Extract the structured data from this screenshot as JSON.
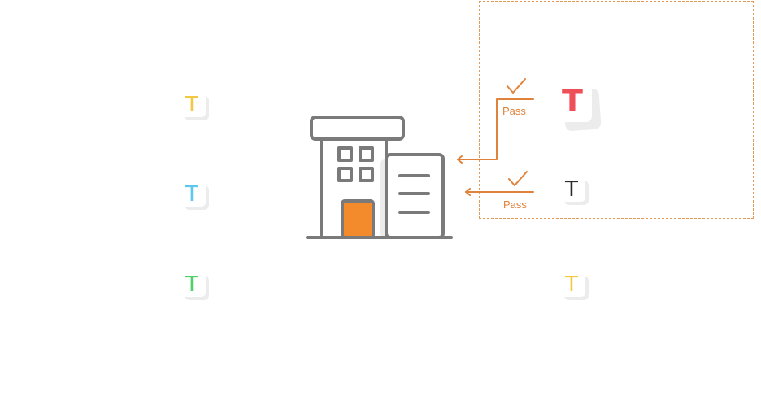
{
  "connectors": [
    {
      "label": "Pass",
      "color": "#e0823a"
    },
    {
      "label": "Pass",
      "color": "#e0823a"
    }
  ],
  "tiles": {
    "left": [
      {
        "glyph": "T",
        "color": "#f5c842"
      },
      {
        "glyph": "T",
        "color": "#5cc8f0"
      },
      {
        "glyph": "T",
        "color": "#4fd16a"
      }
    ],
    "right": [
      {
        "glyph": "T",
        "color": "#ef4f57"
      },
      {
        "glyph": "T",
        "color": "#2b2b2b"
      },
      {
        "glyph": "T",
        "color": "#f5c842"
      }
    ]
  },
  "building": {
    "outline_color": "#7a7a7a",
    "door_color": "#f38b2c"
  },
  "icons": [
    "building-icon",
    "checkmark-icon",
    "arrow-left-icon"
  ]
}
